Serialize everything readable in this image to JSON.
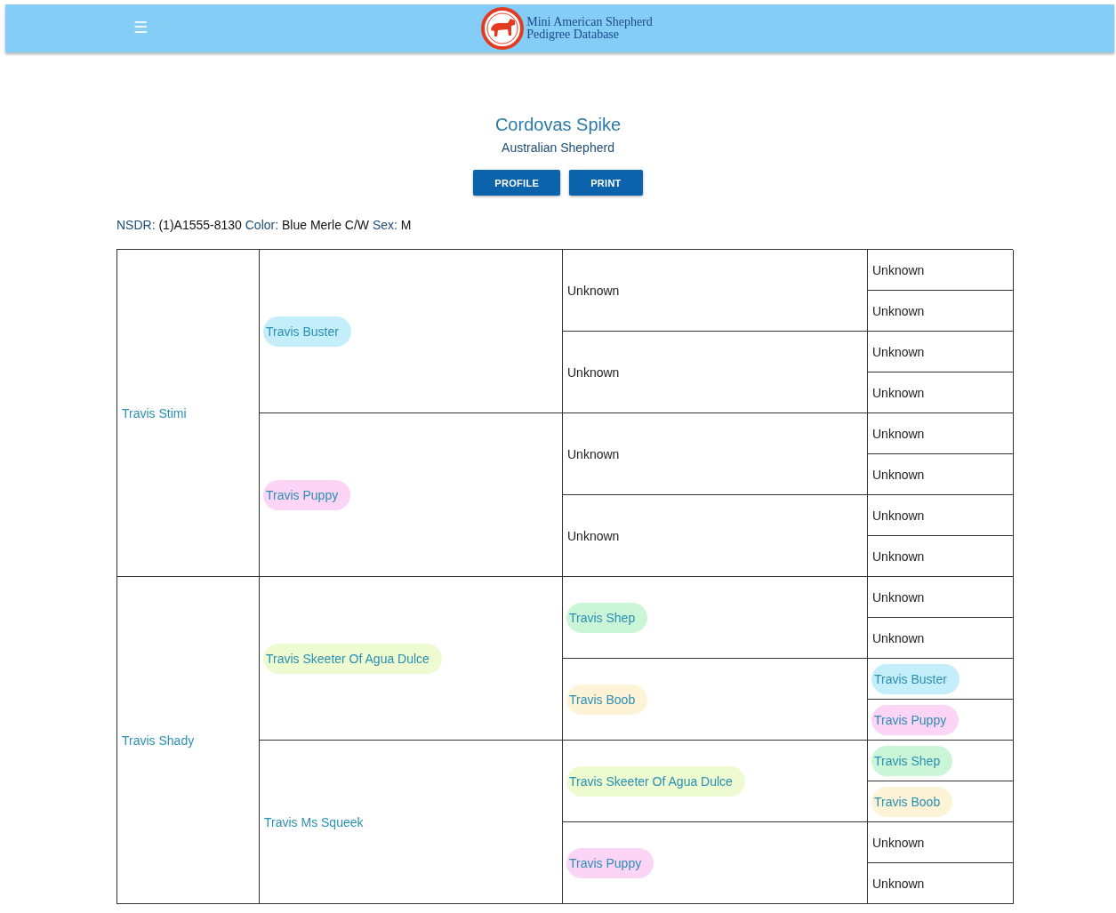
{
  "header": {
    "menu_icon": "☰",
    "site_title_lines": [
      "Mini American Shepherd",
      "Pedigree Database"
    ]
  },
  "dog": {
    "name": "Cordovas Spike",
    "breed": "Australian Shepherd"
  },
  "buttons": [
    "PROFILE",
    "PRINT"
  ],
  "details": [
    {
      "label": "NSDR:",
      "value": "(1)A1555-8130"
    },
    {
      "label": "Color:",
      "value": "Blue Merle C/W"
    },
    {
      "label": "Sex:",
      "value": "M"
    }
  ],
  "pedigree": [
    {
      "name": "Travis Stimi",
      "kind": "link",
      "children": [
        {
          "name": "Travis Buster",
          "kind": "link",
          "color": "#c4eefa",
          "children": [
            {
              "name": "Unknown",
              "kind": "unknown",
              "children": [
                {
                  "name": "Unknown",
                  "kind": "unknown"
                },
                {
                  "name": "Unknown",
                  "kind": "unknown"
                }
              ]
            },
            {
              "name": "Unknown",
              "kind": "unknown",
              "children": [
                {
                  "name": "Unknown",
                  "kind": "unknown"
                },
                {
                  "name": "Unknown",
                  "kind": "unknown"
                }
              ]
            }
          ]
        },
        {
          "name": "Travis Puppy",
          "kind": "link",
          "color": "#fbd4f6",
          "children": [
            {
              "name": "Unknown",
              "kind": "unknown",
              "children": [
                {
                  "name": "Unknown",
                  "kind": "unknown"
                },
                {
                  "name": "Unknown",
                  "kind": "unknown"
                }
              ]
            },
            {
              "name": "Unknown",
              "kind": "unknown",
              "children": [
                {
                  "name": "Unknown",
                  "kind": "unknown"
                },
                {
                  "name": "Unknown",
                  "kind": "unknown"
                }
              ]
            }
          ]
        }
      ]
    },
    {
      "name": "Travis Shady",
      "kind": "link",
      "children": [
        {
          "name": "Travis Skeeter Of Agua Dulce",
          "kind": "link",
          "color": "#eefad0",
          "children": [
            {
              "name": "Travis Shep",
              "kind": "link",
              "color": "#caf5d6",
              "children": [
                {
                  "name": "Unknown",
                  "kind": "unknown"
                },
                {
                  "name": "Unknown",
                  "kind": "unknown"
                }
              ]
            },
            {
              "name": "Travis Boob",
              "kind": "link",
              "color": "#fdf3d6",
              "children": [
                {
                  "name": "Travis Buster",
                  "kind": "link",
                  "color": "#c4eefa"
                },
                {
                  "name": "Travis Puppy",
                  "kind": "link",
                  "color": "#fbd4f6"
                }
              ]
            }
          ]
        },
        {
          "name": "Travis Ms Squeek",
          "kind": "link",
          "children": [
            {
              "name": "Travis Skeeter Of Agua Dulce",
              "kind": "link",
              "color": "#eefad0",
              "children": [
                {
                  "name": "Travis Shep",
                  "kind": "link",
                  "color": "#caf5d6"
                },
                {
                  "name": "Travis Boob",
                  "kind": "link",
                  "color": "#fdf3d6"
                }
              ]
            },
            {
              "name": "Travis Puppy",
              "kind": "link",
              "color": "#fbd4f6",
              "children": [
                {
                  "name": "Unknown",
                  "kind": "unknown"
                },
                {
                  "name": "Unknown",
                  "kind": "unknown"
                }
              ]
            }
          ]
        }
      ]
    }
  ]
}
